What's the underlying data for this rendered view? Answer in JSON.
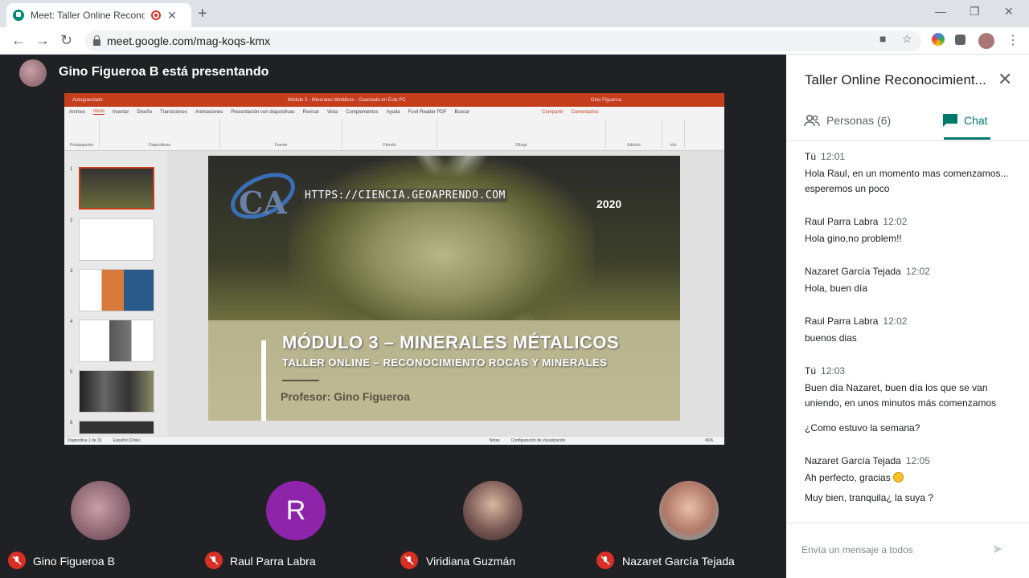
{
  "browser": {
    "tab_title": "Meet: Taller Online Reconocimiento",
    "url": "meet.google.com/mag-koqs-kmx"
  },
  "presenter": {
    "label": "Gino Figueroa B está presentando"
  },
  "ppt": {
    "title_bar": "Módulo 3 - Minerales Metálicos - Guardado en Este PC",
    "user": "Gino Figueroa",
    "autosave": "Autoguardado",
    "tabs": [
      "Archivo",
      "Inicio",
      "Insertar",
      "Diseño",
      "Transiciones",
      "Animaciones",
      "Presentación con diapositivas",
      "Revisar",
      "Vista",
      "Complementos",
      "Ayuda",
      "Foxit Reader PDF",
      "Buscar"
    ],
    "share": "Compartir",
    "comments": "Comentarios",
    "groups": [
      "Portapapeles",
      "Diapositivas",
      "Fuente",
      "Párrafo",
      "Dibujo",
      "Edición",
      "Voz"
    ],
    "status_left": "Diapositiva 1 de 32",
    "status_lang": "Español (Chile)",
    "status_notes": "Notas",
    "status_view": "Configuración de visualización",
    "zoom": "66%",
    "thumb_numbers": [
      "1",
      "2",
      "3",
      "4",
      "5",
      "6"
    ]
  },
  "slide": {
    "url": "HTTPS://CIENCIA.GEOAPRENDO.COM",
    "year": "2020",
    "heading": "MÓDULO 3 – MINERALES MÉTALICOS",
    "subheading": "TALLER ONLINE – RECONOCIMIENTO ROCAS Y MINERALES",
    "professor": "Profesor: Gino Figueroa",
    "logo_text": "CA"
  },
  "participants": [
    {
      "name": "Gino Figueroa B",
      "initial": ""
    },
    {
      "name": "Raul Parra Labra",
      "initial": "R"
    },
    {
      "name": "Viridiana Guzmán",
      "initial": ""
    },
    {
      "name": "Nazaret García Tejada",
      "initial": ""
    }
  ],
  "panel": {
    "title": "Taller Online Reconocimient...",
    "people_tab": "Personas (6)",
    "chat_tab": "Chat",
    "compose_placeholder": "Envía un mensaje a todos"
  },
  "messages": [
    {
      "sender": "Tú",
      "time": "12:01",
      "lines": [
        "Hola Raul, en un momento mas comenzamos... esperemos un poco"
      ]
    },
    {
      "sender": "Raul Parra Labra",
      "time": "12:02",
      "lines": [
        "Hola gino,no problem!!"
      ]
    },
    {
      "sender": "Nazaret García Tejada",
      "time": "12:02",
      "lines": [
        "Hola, buen día"
      ]
    },
    {
      "sender": "Raul Parra Labra",
      "time": "12:02",
      "lines": [
        "buenos dias"
      ]
    },
    {
      "sender": "Tú",
      "time": "12:03",
      "lines": [
        "Buen día Nazaret, buen día los que se van uniendo, en unos minutos más comenzamos",
        "¿Como estuvo la semana?"
      ]
    },
    {
      "sender": "Nazaret García Tejada",
      "time": "12:05",
      "lines": [
        "Ah perfecto, gracias",
        "Muy bien, tranquila¿ la suya ?"
      ]
    }
  ],
  "colors": {
    "meet_bg": "#202124",
    "accent": "#00796b",
    "mic_off": "#d93025",
    "ppt_red": "#c43e1c",
    "avatar_r": "#8e24aa"
  }
}
